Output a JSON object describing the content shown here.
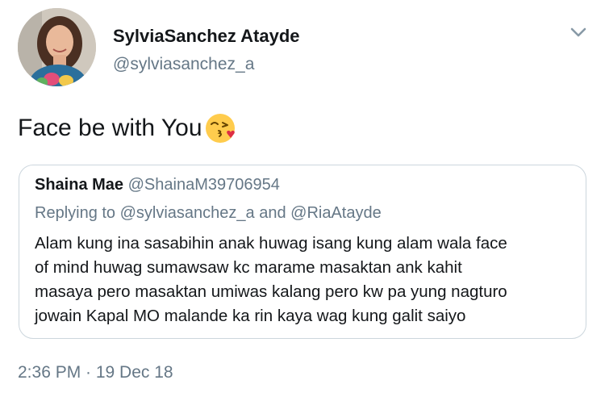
{
  "author": {
    "name": "SylviaSanchez Atayde",
    "handle": "@sylviasanchez_a",
    "avatar_icon": "profile-photo"
  },
  "menu_icon": "chevron-down-icon",
  "tweet": {
    "text": "Face be with You",
    "emoji_icon": "face-blowing-kiss-emoji"
  },
  "quoted_tweet": {
    "name": "Shaina Mae",
    "handle": "@ShainaM39706954",
    "replying_to": "Replying to @sylviasanchez_a and @RiaAtayde",
    "lines": [
      "Alam kung ina sasabihin anak huwag isang kung alam wala face",
      "of mind huwag sumawsaw kc marame masaktan ank kahit",
      "masaya pero masaktan umiwas kalang pero kw pa yung nagturo",
      "jowain Kapal MO malande ka rin kaya wag kung galit saiyo"
    ]
  },
  "timestamp": "2:36 PM · 19 Dec 18",
  "colors": {
    "primary_text": "#14171a",
    "secondary_text": "#657786",
    "border": "#ccd6dd",
    "emoji_yellow": "#ffcc4d",
    "heart_red": "#dd2e44"
  }
}
